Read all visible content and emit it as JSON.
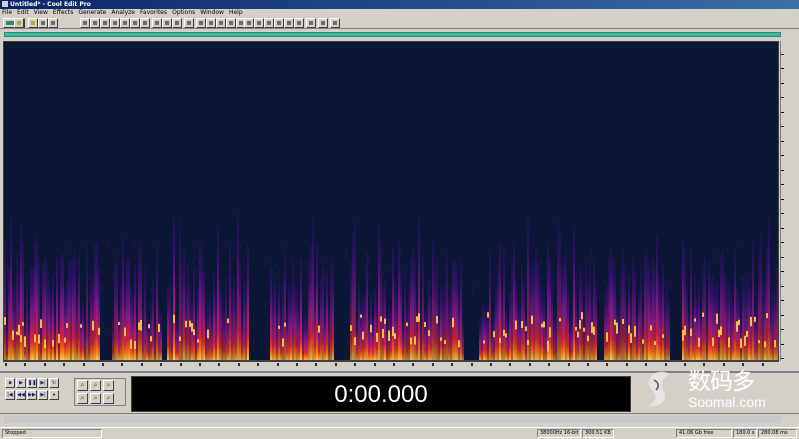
{
  "window": {
    "title": "Untitled* - Cool Edit Pro"
  },
  "menu": [
    "File",
    "Edit",
    "View",
    "Effects",
    "Generate",
    "Analyze",
    "Favorites",
    "Options",
    "Window",
    "Help"
  ],
  "toolbar": {
    "buttons": [
      "waveform-icon",
      "open-icon",
      "save-icon",
      "record-icon",
      "cut-icon",
      "copy-icon",
      "paste-icon",
      "paste-mix-icon",
      "undo-icon",
      "redo-icon",
      "insert-icon",
      "mix-icon",
      "fx-icon",
      "spectral-view-icon",
      "sample-edit-icon",
      "zoom-tool-icon",
      "select-tool-icon",
      "grid-icon",
      "snap-icon",
      "scale-icon",
      "info-icon",
      "help-icon",
      "track-1-icon",
      "track-2-icon",
      "track-3-icon",
      "track-4-icon",
      "track-5-icon",
      "track-6-icon",
      "metronome-icon",
      "cue-icon"
    ]
  },
  "colors": {
    "spectrogram_bg": "#0c1735",
    "overview": "#3fb8a0",
    "time_text": "#ffffff"
  },
  "transport": {
    "row1": [
      "stop-icon",
      "play-icon",
      "pause-icon",
      "play-to-end-icon",
      "loop-icon"
    ],
    "row2": [
      "rewind-start-icon",
      "rewind-icon",
      "fast-forward-icon",
      "forward-end-icon",
      "record-icon"
    ]
  },
  "zoom": {
    "buttons": [
      "zoom-in-horizontal-icon",
      "zoom-out-horizontal-icon",
      "zoom-full-icon",
      "zoom-in-vertical-icon",
      "zoom-out-vertical-icon",
      "zoom-selection-icon"
    ]
  },
  "time_display": "0:00.000",
  "watermark": {
    "cn": "数码多",
    "en": "Soomal.com"
  },
  "status": {
    "state": "Stopped",
    "format": "38000Hz 16-bit",
    "size": "300.51 KB",
    "free": "41.06 Gb free",
    "time": "180.0 s",
    "scale": "280.08 ms"
  },
  "segments": [
    [
      0,
      95
    ],
    [
      108,
      157
    ],
    [
      163,
      244
    ],
    [
      266,
      330
    ],
    [
      346,
      460
    ],
    [
      475,
      593
    ],
    [
      600,
      665
    ],
    [
      678,
      776
    ]
  ]
}
